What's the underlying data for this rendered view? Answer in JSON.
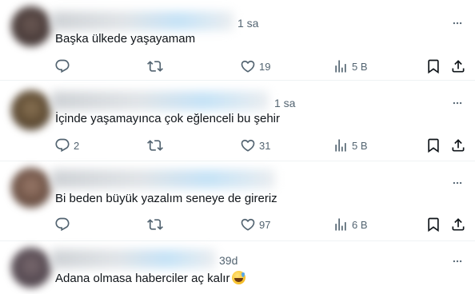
{
  "tweets": [
    {
      "time": "1 sa",
      "text": "Başka ülkede yaşayamam",
      "reply_count": "",
      "repost_count": "",
      "like_count": "19",
      "view_count": "5 B"
    },
    {
      "time": "1 sa",
      "text": "İçinde yaşamayınca çok eğlenceli bu şehir",
      "reply_count": "2",
      "repost_count": "",
      "like_count": "31",
      "view_count": "5 B"
    },
    {
      "time": "",
      "text": "Bi beden büyük yazalım seneye de gireriz",
      "reply_count": "",
      "repost_count": "",
      "like_count": "97",
      "view_count": "6 B"
    },
    {
      "time": "39d",
      "text": "Adana olmasa haberciler aç kalır",
      "emoji": "grinning-face-with-sweat"
    }
  ],
  "icons": {
    "reply": "reply-icon",
    "repost": "repost-icon",
    "like": "like-icon",
    "views": "views-icon",
    "bookmark": "bookmark-icon",
    "share": "share-icon",
    "more": "more-icon"
  },
  "colors": {
    "text": "#0f1419",
    "secondary": "#536471",
    "divider": "#eff3f4",
    "verified": "#1d9bf0"
  }
}
